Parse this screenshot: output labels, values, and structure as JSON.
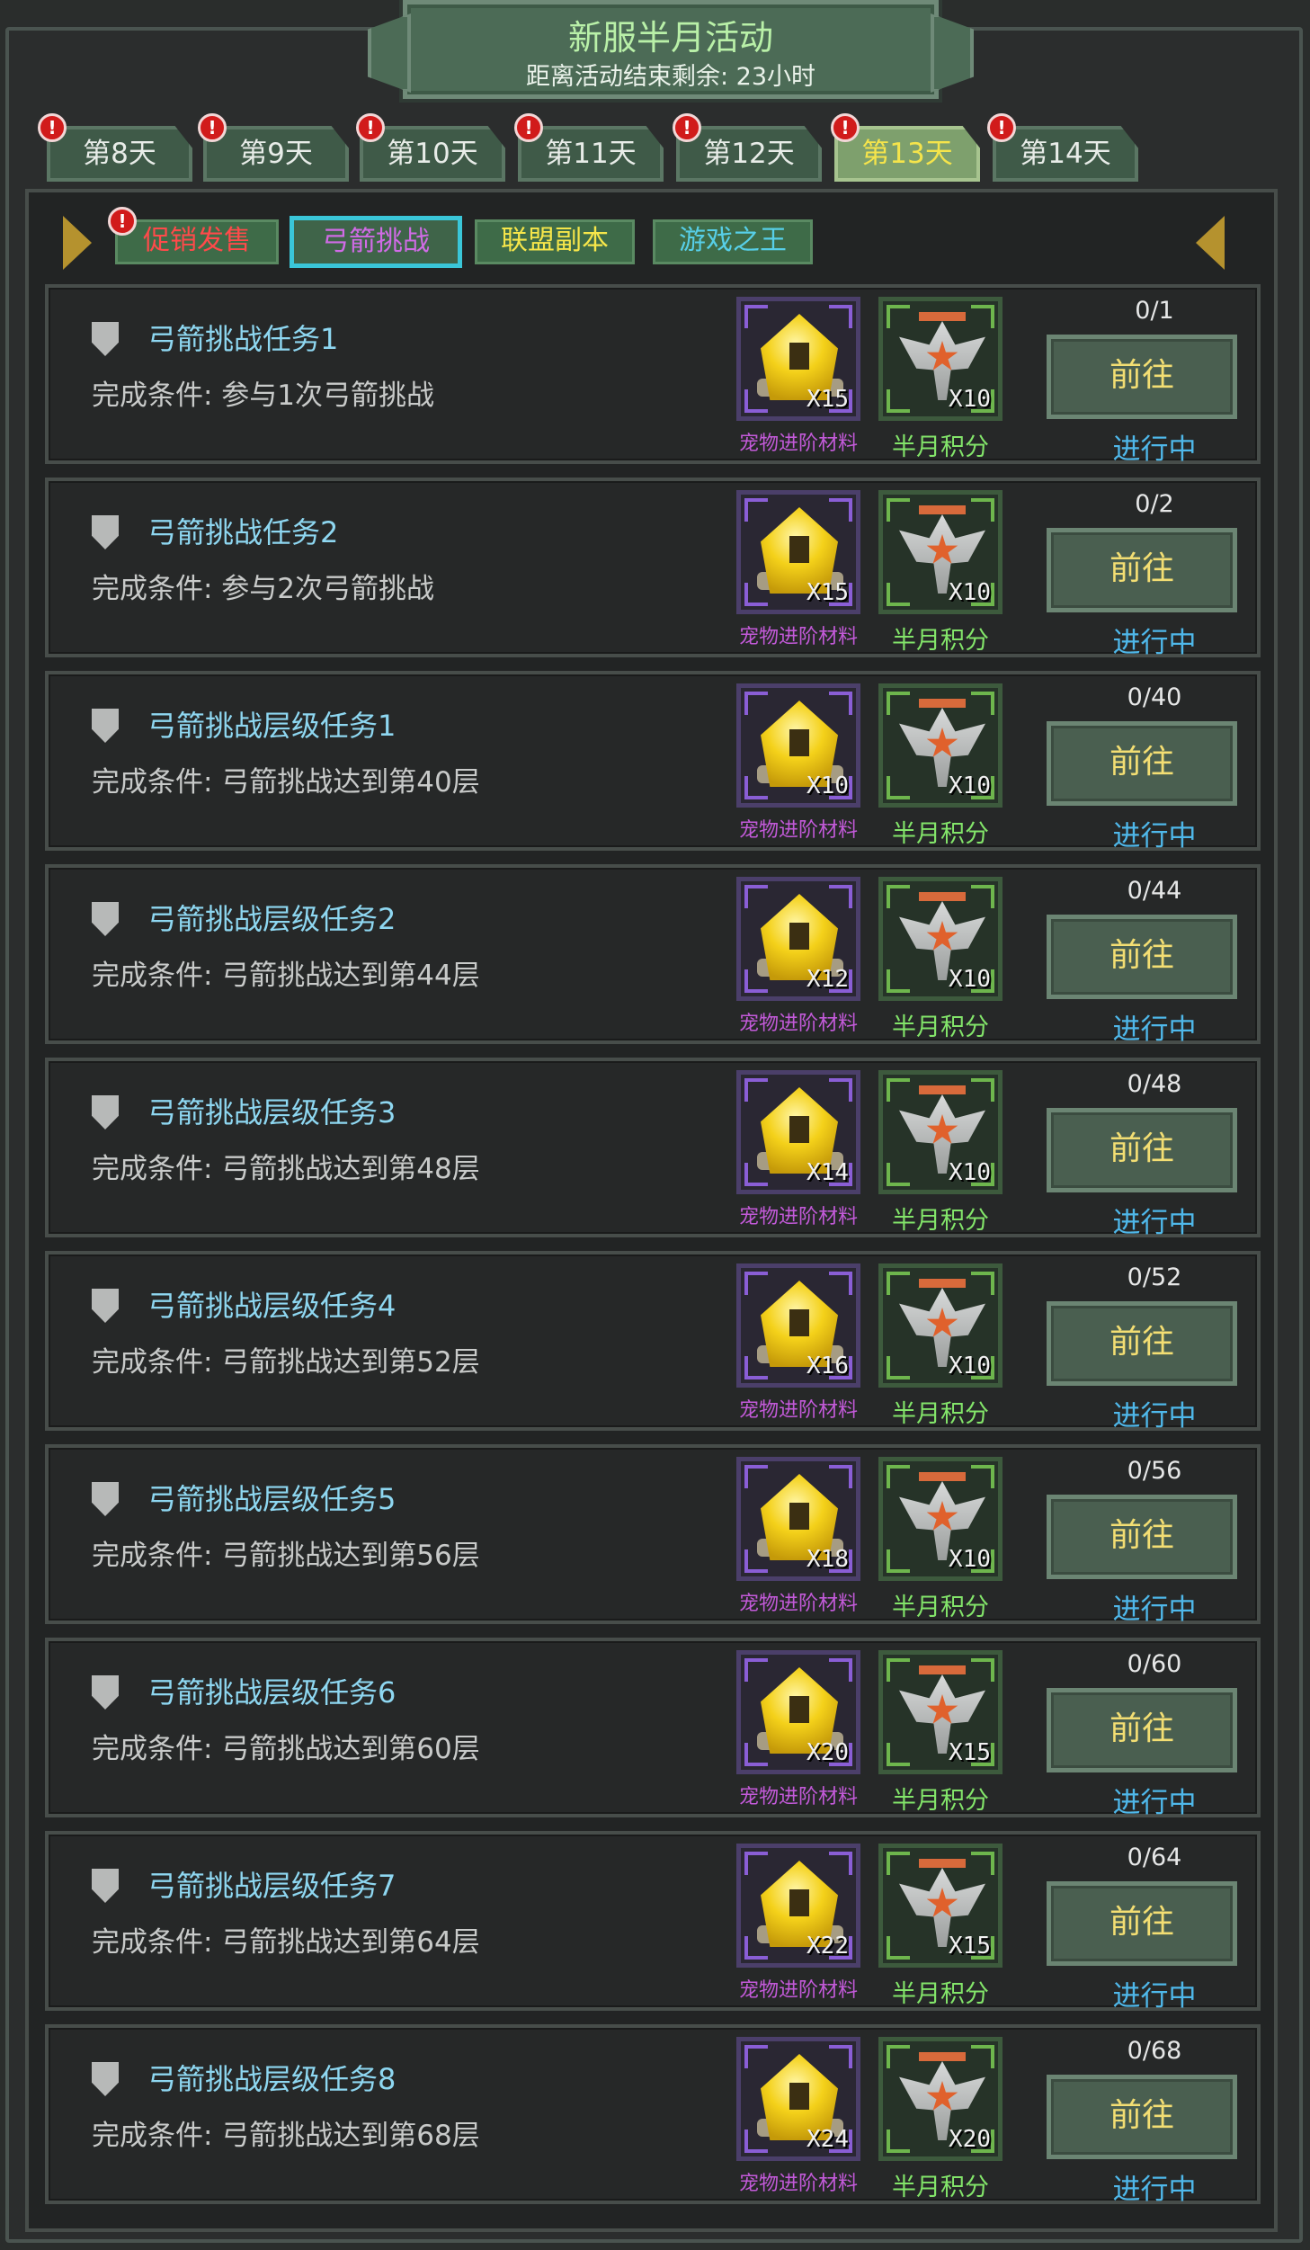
{
  "header": {
    "title": "新服半月活动",
    "subtitle": "距离活动结束剩余: 23小时"
  },
  "day_tabs": [
    {
      "label": "第8天",
      "alert": "!",
      "active": false
    },
    {
      "label": "第9天",
      "alert": "!",
      "active": false
    },
    {
      "label": "第10天",
      "alert": "!",
      "active": false
    },
    {
      "label": "第11天",
      "alert": "!",
      "active": false
    },
    {
      "label": "第12天",
      "alert": "!",
      "active": false
    },
    {
      "label": "第13天",
      "alert": "!",
      "active": true
    },
    {
      "label": "第14天",
      "alert": "!",
      "active": false
    }
  ],
  "sub_tabs": [
    {
      "label": "促销发售",
      "color": "#ff4a4a",
      "alert": "!",
      "active": false
    },
    {
      "label": "弓箭挑战",
      "color": "#d06be6",
      "active": true,
      "active_border": "#3ac6d8"
    },
    {
      "label": "联盟副本",
      "color": "#f6e64a",
      "active": false
    },
    {
      "label": "游戏之王",
      "color": "#57cfe8",
      "active": false
    }
  ],
  "reward_labels": {
    "item1": "宠物进阶材料",
    "item2": "半月积分"
  },
  "button_label": "前往",
  "status_label": "进行中",
  "tasks": [
    {
      "name": "弓箭挑战任务1",
      "condition": "完成条件: 参与1次弓箭挑战",
      "item1_qty": "X15",
      "item2_qty": "X10",
      "progress": "0/1"
    },
    {
      "name": "弓箭挑战任务2",
      "condition": "完成条件: 参与2次弓箭挑战",
      "item1_qty": "X15",
      "item2_qty": "X10",
      "progress": "0/2"
    },
    {
      "name": "弓箭挑战层级任务1",
      "condition": "完成条件: 弓箭挑战达到第40层",
      "item1_qty": "X10",
      "item2_qty": "X10",
      "progress": "0/40"
    },
    {
      "name": "弓箭挑战层级任务2",
      "condition": "完成条件: 弓箭挑战达到第44层",
      "item1_qty": "X12",
      "item2_qty": "X10",
      "progress": "0/44"
    },
    {
      "name": "弓箭挑战层级任务3",
      "condition": "完成条件: 弓箭挑战达到第48层",
      "item1_qty": "X14",
      "item2_qty": "X10",
      "progress": "0/48"
    },
    {
      "name": "弓箭挑战层级任务4",
      "condition": "完成条件: 弓箭挑战达到第52层",
      "item1_qty": "X16",
      "item2_qty": "X10",
      "progress": "0/52"
    },
    {
      "name": "弓箭挑战层级任务5",
      "condition": "完成条件: 弓箭挑战达到第56层",
      "item1_qty": "X18",
      "item2_qty": "X10",
      "progress": "0/56"
    },
    {
      "name": "弓箭挑战层级任务6",
      "condition": "完成条件: 弓箭挑战达到第60层",
      "item1_qty": "X20",
      "item2_qty": "X15",
      "progress": "0/60"
    },
    {
      "name": "弓箭挑战层级任务7",
      "condition": "完成条件: 弓箭挑战达到第64层",
      "item1_qty": "X22",
      "item2_qty": "X15",
      "progress": "0/64"
    },
    {
      "name": "弓箭挑战层级任务8",
      "condition": "完成条件: 弓箭挑战达到第68层",
      "item1_qty": "X24",
      "item2_qty": "X20",
      "progress": "0/68"
    }
  ]
}
